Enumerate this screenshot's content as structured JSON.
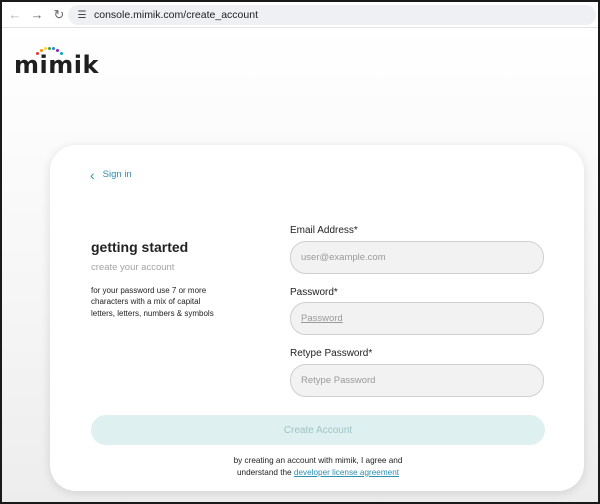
{
  "browser": {
    "back_icon": "arrow-left-icon",
    "forward_icon": "arrow-right-icon",
    "reload_icon": "reload-icon",
    "site_settings_icon": "site-settings-icon",
    "url": "console.mimik.com/create_account"
  },
  "logo": {
    "text": "mimik",
    "dot_colors": [
      "#e53935",
      "#fb8c00",
      "#fdd835",
      "#43a047",
      "#1e88e5",
      "#8e24aa",
      "#00acc1"
    ]
  },
  "form": {
    "back_link": "Sign in",
    "heading": "getting started",
    "subheading": "create your account",
    "password_hint": "for your password use 7 or more characters with a mix of capital letters, letters, numbers & symbols",
    "email_label": "Email Address*",
    "email_placeholder": "user@example.com",
    "password_label": "Password*",
    "password_placeholder": "Password",
    "retype_label": "Retype Password*",
    "retype_placeholder": "Retype Password",
    "submit_label": "Create Account",
    "agree_text": "by creating an account with mimik, I agree and",
    "agree_text2": "understand the",
    "agree_link": "developer license agreement"
  },
  "colors": {
    "link": "#2b8fb0",
    "button_bg": "#dff0f0",
    "button_text": "#9fc4c6"
  }
}
